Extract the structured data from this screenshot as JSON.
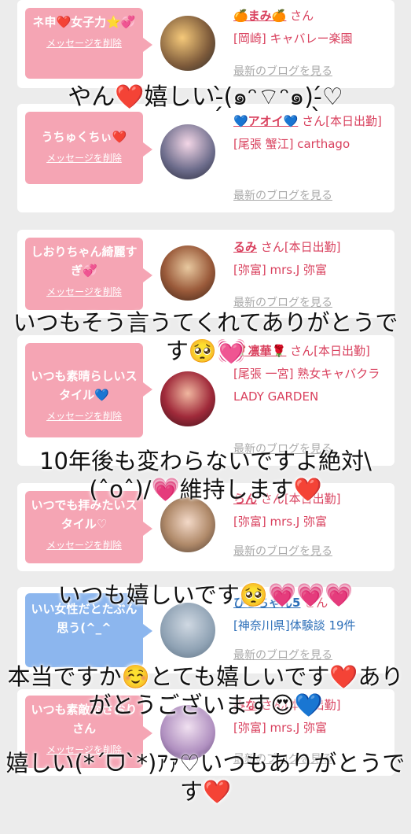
{
  "delete_label": "メッセージを削除",
  "blog_link_label": "最新のブログを見る",
  "san": "さん",
  "cards": [
    {
      "bubble": "ネ申❤️女子力⭐️💞",
      "bubble_color": "pink",
      "name": "🍊まみ🍊",
      "status": "",
      "shop": "[岡崎] キャバレー楽園",
      "name_color": "pink"
    },
    {
      "bubble": "うちゅくちぃ❤️",
      "bubble_color": "pink",
      "name": "💙アオイ💙",
      "status": "[本日出勤]",
      "shop": "[尾張 蟹江] carthago",
      "name_color": "pink"
    },
    {
      "bubble": "しおりちゃん綺麗すぎ💞",
      "bubble_color": "pink",
      "name": "るみ",
      "status": "[本日出勤]",
      "shop": "[弥富] mrs.J 弥富",
      "name_color": "pink"
    },
    {
      "bubble": "いつも素晴らしいスタイル💙",
      "bubble_color": "pink",
      "name": "🌹凛華🌹",
      "status": "[本日出勤]",
      "shop": "[尾張 一宮] 熟女キャバクラ LADY GARDEN",
      "name_color": "pink"
    },
    {
      "bubble": "いつでも拝みたいスタイル♡",
      "bubble_color": "pink",
      "name": "らん",
      "status": "[本日出勤]",
      "shop": "[弥富] mrs.J 弥富",
      "name_color": "pink"
    },
    {
      "bubble": "いい女性だとたぶん思う(^_^",
      "bubble_color": "blue",
      "name": "ひろちゃん5",
      "status": "",
      "shop": "[神奈川県]体験談 19件",
      "name_color": "blue"
    },
    {
      "bubble": "いつも素敵なさおりさん",
      "bubble_color": "pink",
      "name": "みな",
      "status": "[本日出勤]",
      "shop": "[弥富] mrs.J 弥富",
      "name_color": "pink"
    }
  ],
  "overlays": [
    "やん❤️嬉しい-̗̀(๑ᵔ⌔ᵔ๑)-̖́♡",
    "いつもそう言うてくれてありがとうです🥺💓",
    "10年後も変わらないですよ絶対\\(ˆoˆ)/💗維持します❤️",
    "いつも嬉しいです🥺💗💗💗",
    "本当ですか☺️とても嬉しいです❤️ありがとうございます😍💙",
    "嬉しい(*ˊᗜˋ*)ｱｧ♡いつもありがとうです❤️"
  ],
  "colors": {
    "pink_bubble": "#f5a5b4",
    "blue_bubble": "#8cb6ee",
    "name_pink": "#d9415e",
    "name_blue": "#2d6fb8",
    "link_gray": "#aaaaaa",
    "background": "#ececec"
  }
}
